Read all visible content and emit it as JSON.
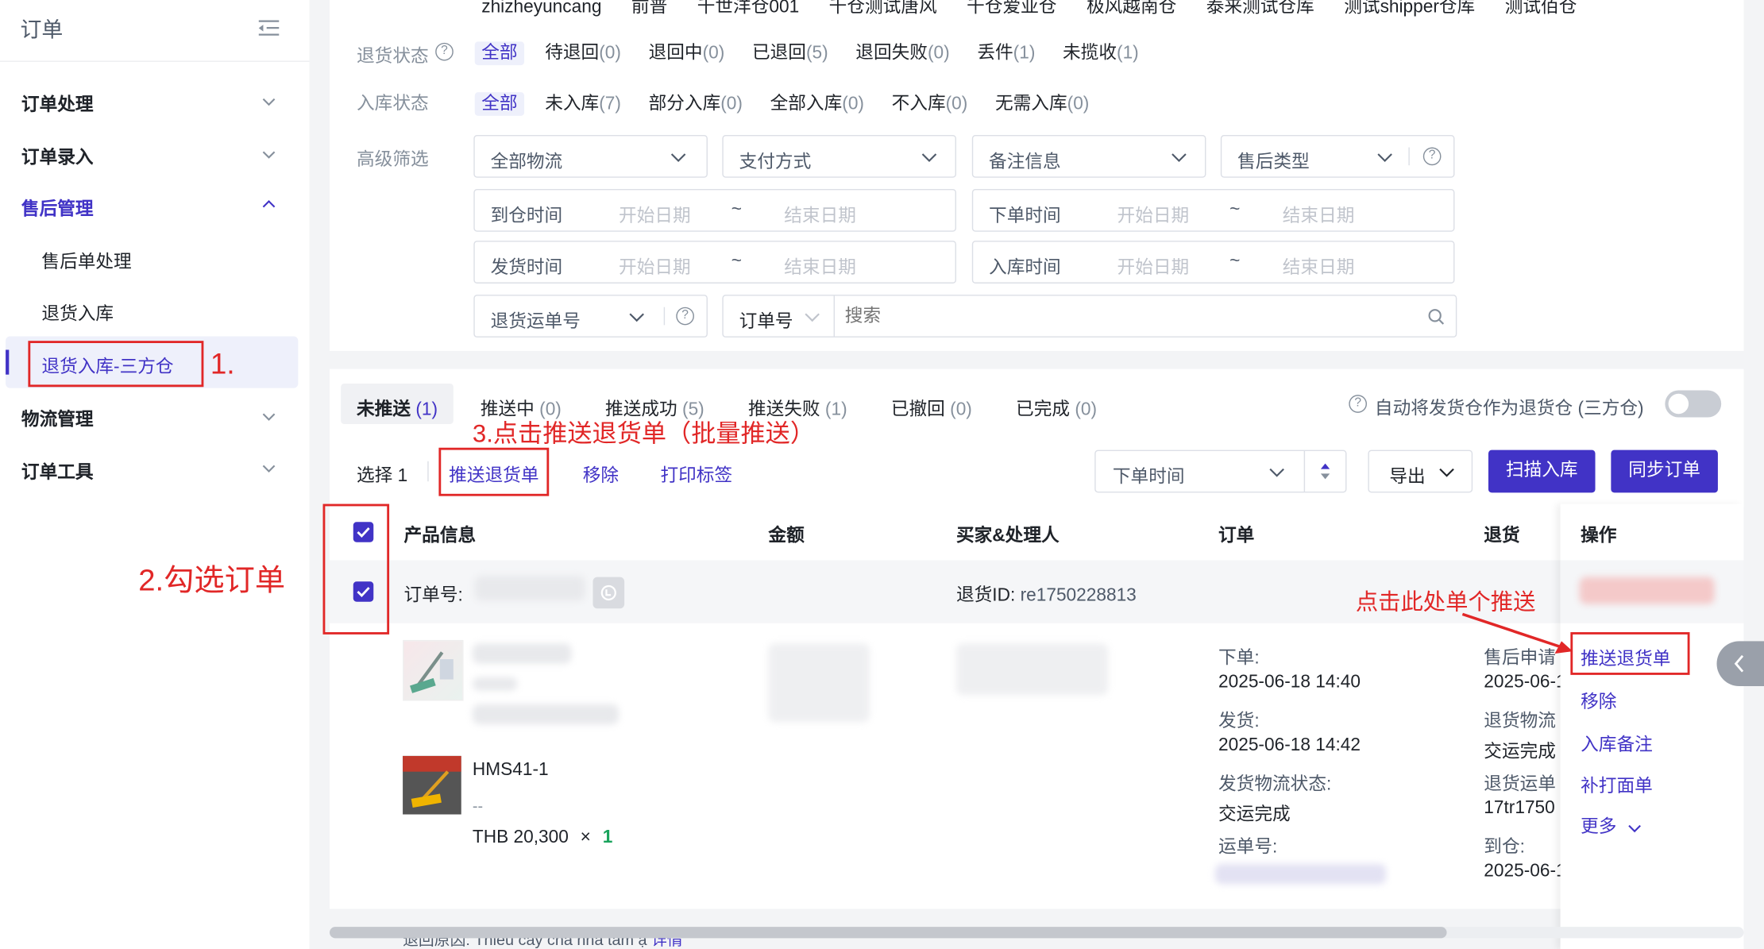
{
  "sidebar": {
    "title": "订单",
    "groups": [
      {
        "label": "订单处理"
      },
      {
        "label": "订单录入"
      },
      {
        "label": "售后管理"
      },
      {
        "label": "物流管理"
      },
      {
        "label": "订单工具"
      }
    ],
    "sub_items": [
      {
        "label": "售后单处理"
      },
      {
        "label": "退货入库"
      },
      {
        "label": "退货入库-三方仓"
      }
    ]
  },
  "warehouses": [
    "zhizheyuncang",
    "前普",
    "千世洋仓001",
    "千仓测试唐风",
    "千仓爱亚仓",
    "极风越南仓",
    "泰来测试仓库",
    "测试shipper仓库",
    "测试佰仓"
  ],
  "filters": {
    "return_status": {
      "label": "退货状态",
      "options": [
        {
          "name": "全部",
          "count": ""
        },
        {
          "name": "待退回",
          "count": "(0)"
        },
        {
          "name": "退回中",
          "count": "(0)"
        },
        {
          "name": "已退回",
          "count": "(5)"
        },
        {
          "name": "退回失败",
          "count": "(0)"
        },
        {
          "name": "丢件",
          "count": "(1)"
        },
        {
          "name": "未揽收",
          "count": "(1)"
        }
      ]
    },
    "inbound_status": {
      "label": "入库状态",
      "options": [
        {
          "name": "全部",
          "count": ""
        },
        {
          "name": "未入库",
          "count": "(7)"
        },
        {
          "name": "部分入库",
          "count": "(0)"
        },
        {
          "name": "全部入库",
          "count": "(0)"
        },
        {
          "name": "不入库",
          "count": "(0)"
        },
        {
          "name": "无需入库",
          "count": "(0)"
        }
      ]
    },
    "advanced": {
      "label": "高级筛选",
      "selects": [
        "全部物流",
        "支付方式",
        "备注信息",
        "售后类型"
      ],
      "date_ranges": [
        {
          "label": "到仓时间",
          "start": "开始日期",
          "end": "结束日期"
        },
        {
          "label": "下单时间",
          "start": "开始日期",
          "end": "结束日期"
        },
        {
          "label": "发货时间",
          "start": "开始日期",
          "end": "结束日期"
        },
        {
          "label": "入库时间",
          "start": "开始日期",
          "end": "结束日期"
        }
      ],
      "range_sep": "~",
      "tracking_select": "退货运单号",
      "order_select": "订单号",
      "search_placeholder": "搜索"
    }
  },
  "tabs": [
    {
      "label": "未推送",
      "count": "(1)"
    },
    {
      "label": "推送中",
      "count": "(0)"
    },
    {
      "label": "推送成功",
      "count": "(5)"
    },
    {
      "label": "推送失败",
      "count": "(1)"
    },
    {
      "label": "已撤回",
      "count": "(0)"
    },
    {
      "label": "已完成",
      "count": "(0)"
    }
  ],
  "auto_toggle_label": "自动将发货仓作为退货仓 (三方仓)",
  "toolbar": {
    "select_label": "选择 1",
    "push_label": "推送退货单",
    "remove_label": "移除",
    "print_label": "打印标签",
    "sort_label": "下单时间",
    "export_label": "导出",
    "scan_label": "扫描入库",
    "sync_label": "同步订单"
  },
  "table": {
    "headers": [
      "产品信息",
      "金额",
      "买家&处理人",
      "订单",
      "退货",
      "操作"
    ],
    "order_no_label": "订单号:",
    "return_id_label": "退货ID:",
    "return_id": "re1750228813",
    "product": {
      "sku": "HMS41-1",
      "dash": "--",
      "price": "THB 20,300",
      "times": "×",
      "qty": "1"
    },
    "order_info": [
      {
        "label": "下单:",
        "value": "2025-06-18 14:40"
      },
      {
        "label": "发货:",
        "value": "2025-06-18 14:42"
      },
      {
        "label": "发货物流状态:",
        "value": "交运完成"
      },
      {
        "label": "运单号:",
        "value": ""
      }
    ],
    "return_info": [
      {
        "label": "售后申请",
        "value": "2025-06-1"
      },
      {
        "label": "退货物流",
        "value": "交运完成"
      },
      {
        "label": "退货运单",
        "value": "17tr1750"
      },
      {
        "label": "到仓:",
        "value": "2025-06-1"
      }
    ],
    "actions": [
      "推送退货单",
      "移除",
      "入库备注",
      "补打面单",
      "更多"
    ],
    "footer_text": "退回原因: Thiếu cây chà nhà tấm ạ",
    "footer_link": "详情"
  },
  "annotations": {
    "step1": "1.",
    "step2": "2.勾选订单",
    "step3": "3.点击推送退货单（批量推送）",
    "single": "点击此处单个推送"
  },
  "colors": {
    "accent": "#4133c6",
    "annotation": "#e12727",
    "success": "#1aa35c"
  }
}
